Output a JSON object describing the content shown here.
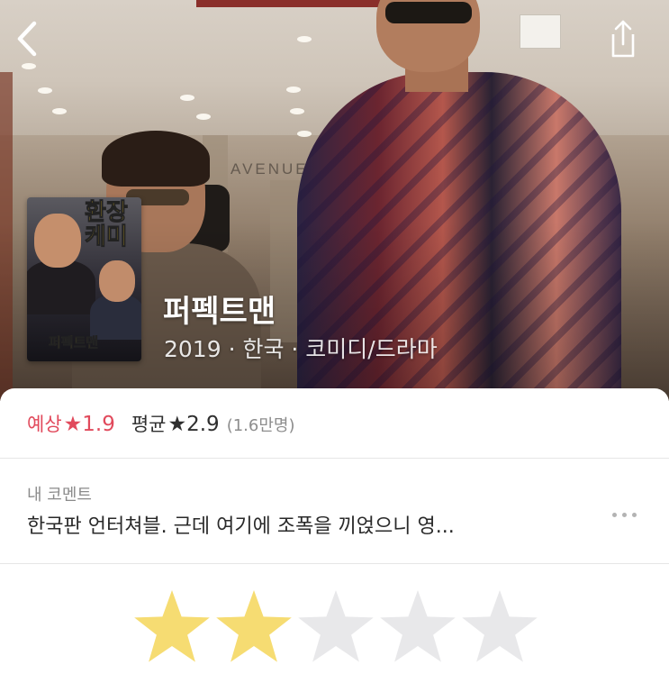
{
  "movie": {
    "title": "퍼펙트맨",
    "meta": "2019 · 한국 · 코미디/드라마",
    "poster": {
      "headline": "환장케미",
      "title_text": "퍼펙트맨"
    }
  },
  "ratings": {
    "expected_label": "예상",
    "expected_value": "★1.9",
    "average_label": "평균",
    "average_value": "★2.9",
    "count": "(1.6만명)"
  },
  "comment": {
    "label": "내 코멘트",
    "text": "한국판 언터쳐블. 근데 여기에 조폭을 끼얹으니 영..."
  },
  "my_rating": {
    "stars_filled": 2,
    "stars_total": 5
  },
  "icons": {
    "back": "chevron-left-icon",
    "share": "share-icon",
    "more": "more-horizontal-icon",
    "star": "star-icon"
  },
  "colors": {
    "accent": "#e14a5c",
    "star_filled": "#f6dc72",
    "star_empty": "#e8e8ea"
  }
}
